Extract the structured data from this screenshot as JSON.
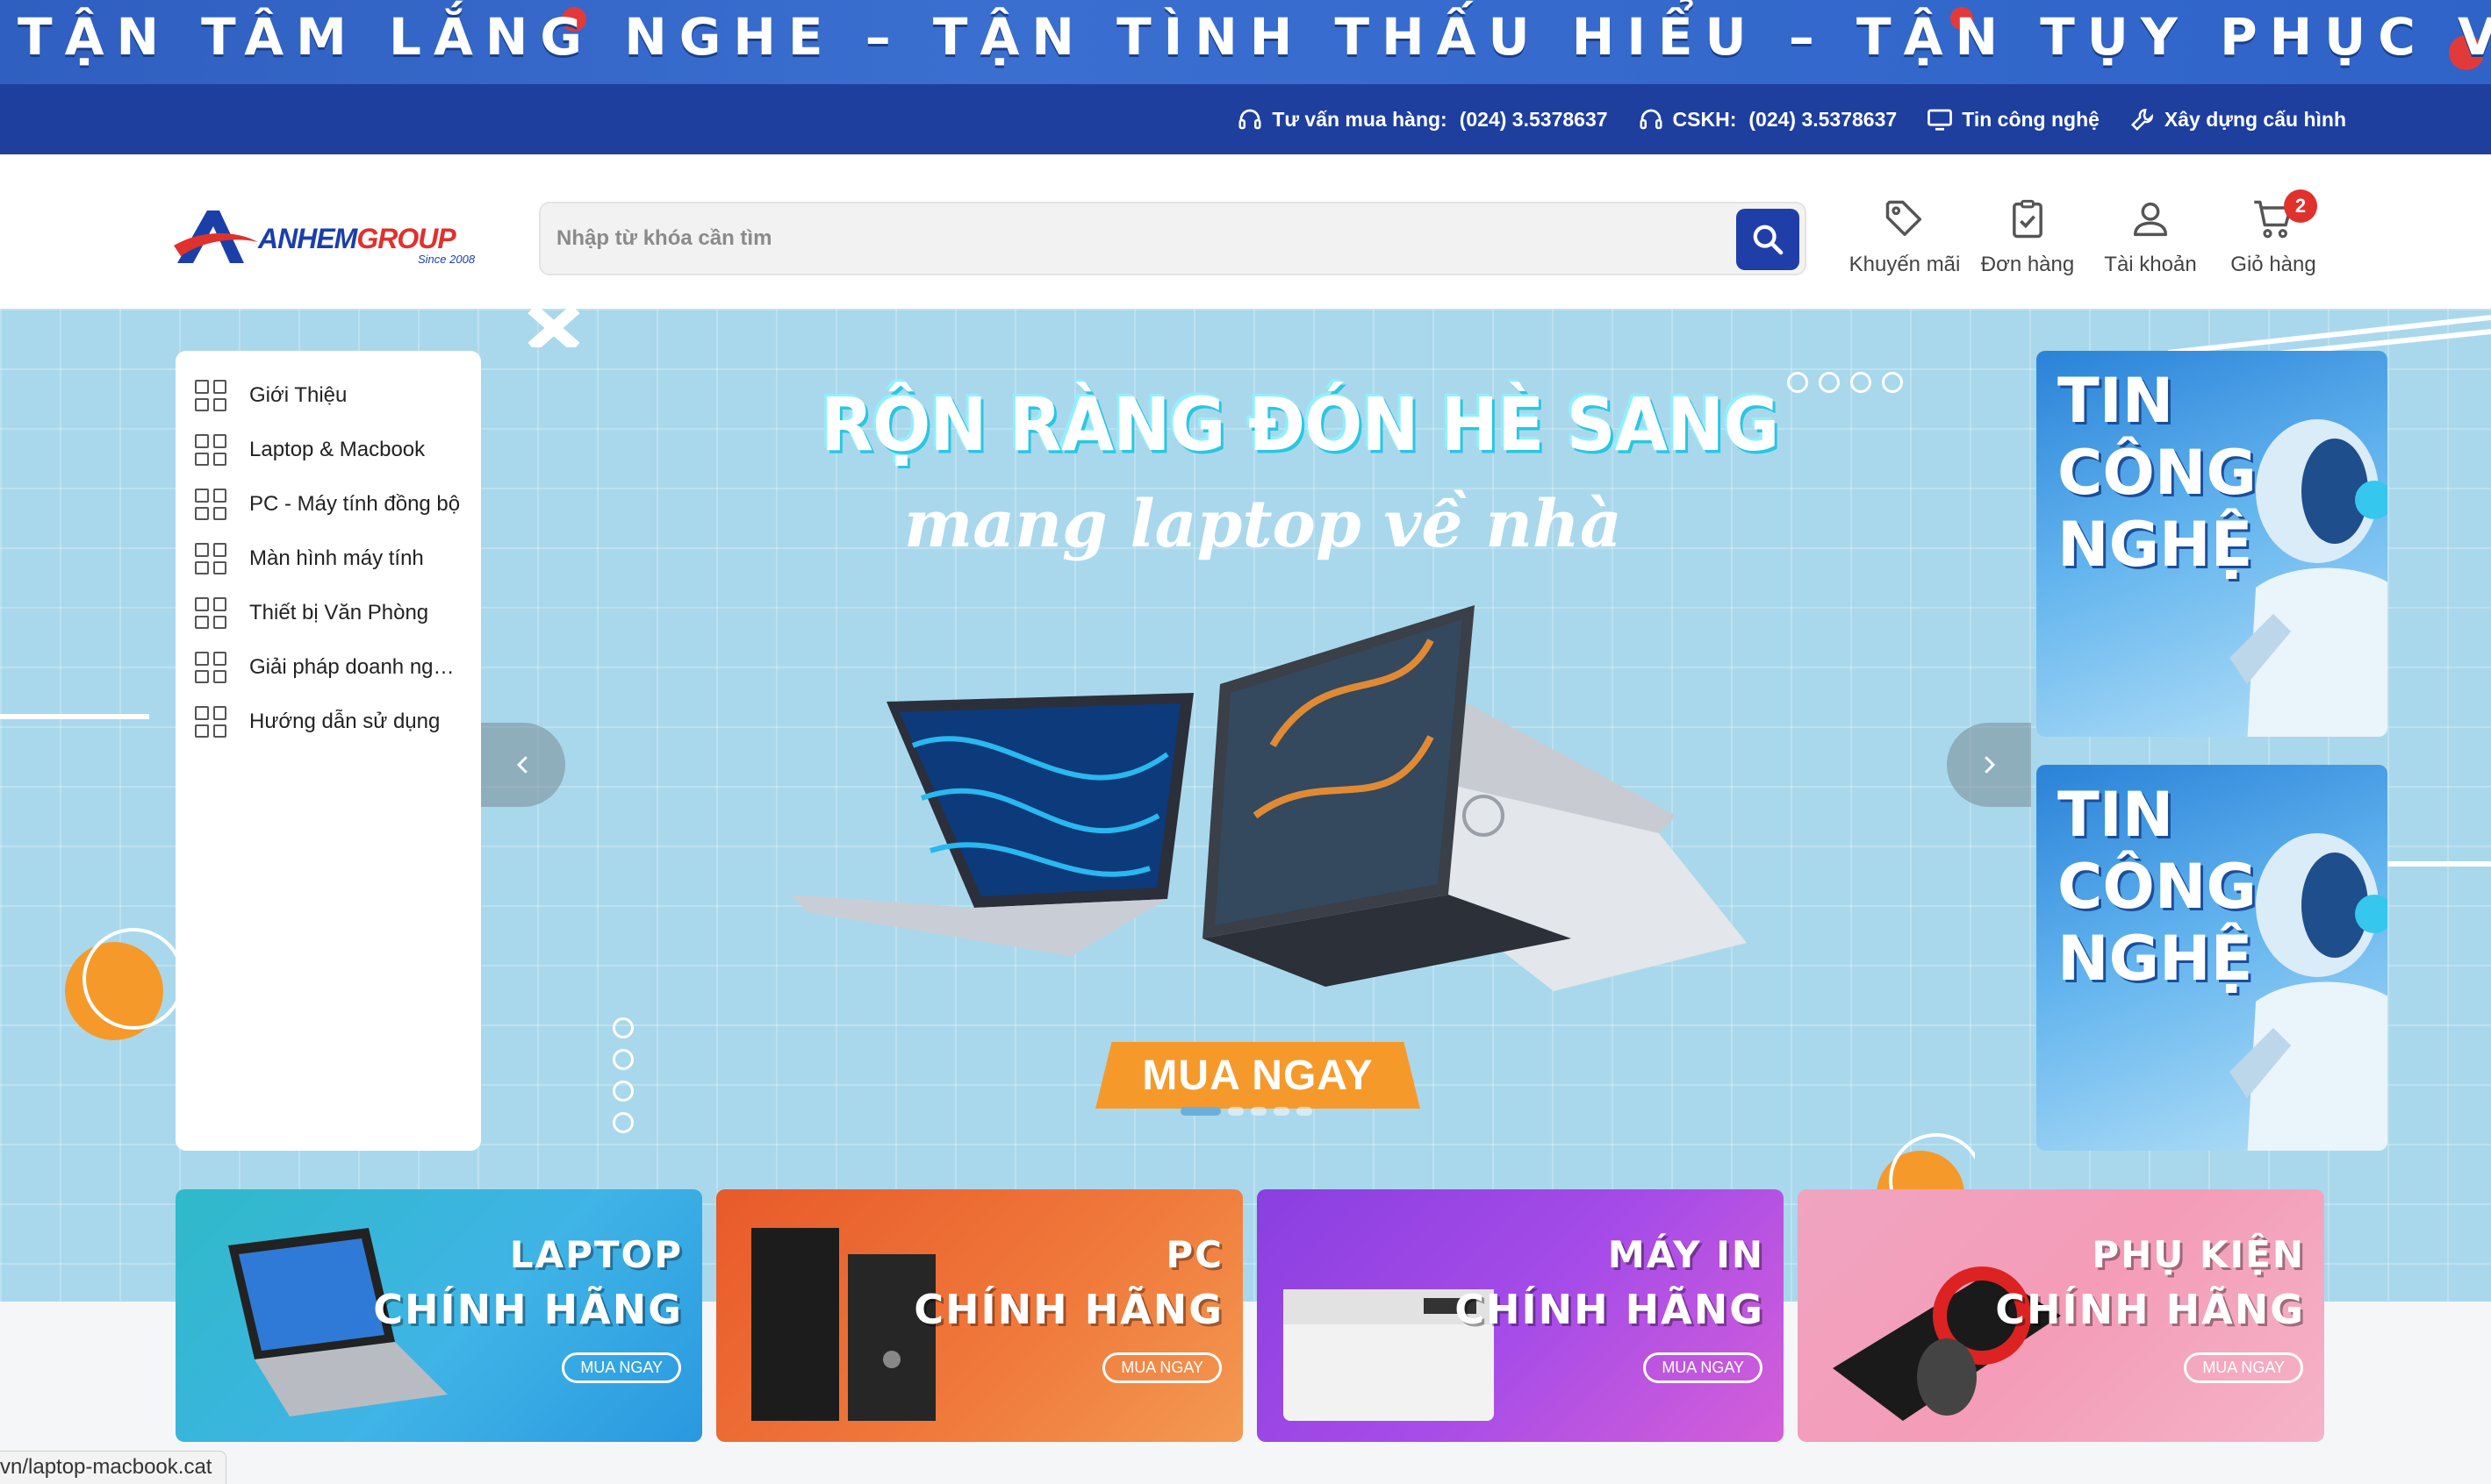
{
  "slogan": "TẬN TÂM LẮNG NGHE – TẬN TÌNH THẤU HIỂU – TẬN TỤY PHỤC VỤ",
  "util_nav": {
    "sales_label": "Tư vấn mua hàng:",
    "sales_phone": "(024) 3.5378637",
    "cskh_label": "CSKH:",
    "cskh_phone": "(024) 3.5378637",
    "tech_news": "Tin công nghệ",
    "build_pc": "Xây dựng cấu hình"
  },
  "logo": {
    "anhem": "ANHEM",
    "group": "GROUP",
    "since": "Since 2008"
  },
  "search": {
    "placeholder": "Nhập từ khóa cần tìm",
    "value": ""
  },
  "header_actions": {
    "promo": "Khuyến mãi",
    "orders": "Đơn hàng",
    "account": "Tài khoản",
    "cart": "Giỏ hàng",
    "cart_count": "2"
  },
  "categories": [
    "Giới Thiệu",
    "Laptop & Macbook",
    "PC - Máy tính đồng bộ",
    "Màn hình máy tính",
    "Thiết bị Văn Phòng",
    "Giải pháp doanh ng…",
    "Hướng dẫn sử dụng"
  ],
  "hero": {
    "title": "RỘN RÀNG ĐÓN HÈ SANG",
    "subtitle": "mang laptop về nhà",
    "cta": "MUA NGAY"
  },
  "promo_cards": [
    {
      "line1": "TIN",
      "line2": "CÔNG",
      "line3": "NGHỆ"
    },
    {
      "line1": "TIN",
      "line2": "CÔNG",
      "line3": "NGHỆ"
    }
  ],
  "category_banners": [
    {
      "line1": "LAPTOP",
      "line2": "CHÍNH HÃNG",
      "button": "MUA NGAY"
    },
    {
      "line1": "PC",
      "line2": "CHÍNH HÃNG",
      "button": "MUA NGAY"
    },
    {
      "line1": "MÁY IN",
      "line2": "CHÍNH HÃNG",
      "button": "MUA NGAY"
    },
    {
      "line1": "PHỤ KIỆN",
      "line2": "CHÍNH HÃNG",
      "button": "MUA NGAY"
    }
  ],
  "status_url": "vn/laptop-macbook.cat",
  "colors": {
    "brand_blue": "#1e3f9e",
    "accent_red": "#e0312d",
    "cta_orange": "#f59a2a",
    "hero_bg": "#a9d8ec"
  }
}
